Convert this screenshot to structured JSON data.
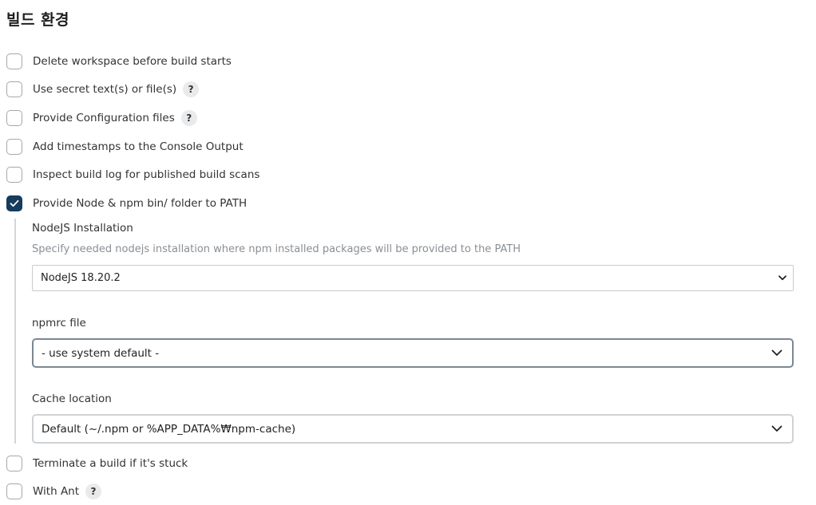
{
  "section": {
    "title": "빌드 환경"
  },
  "options": [
    {
      "label": "Delete workspace before build starts",
      "checked": false,
      "help": false
    },
    {
      "label": "Use secret text(s) or file(s)",
      "checked": false,
      "help": true
    },
    {
      "label": "Provide Configuration files",
      "checked": false,
      "help": true
    },
    {
      "label": "Add timestamps to the Console Output",
      "checked": false,
      "help": false
    },
    {
      "label": "Inspect build log for published build scans",
      "checked": false,
      "help": false
    },
    {
      "label": "Provide Node & npm bin/ folder to PATH",
      "checked": true,
      "help": false
    },
    {
      "label": "Terminate a build if it's stuck",
      "checked": false,
      "help": false
    },
    {
      "label": "With Ant",
      "checked": false,
      "help": true
    }
  ],
  "help_glyph": "?",
  "node_settings": {
    "nodejs_label": "NodeJS Installation",
    "nodejs_description": "Specify needed nodejs installation where npm installed packages will be provided to the PATH",
    "nodejs_value": "NodeJS 18.20.2",
    "npmrc_label": "npmrc file",
    "npmrc_value": "- use system default -",
    "cache_label": "Cache location",
    "cache_value": "Default (~/.npm or %APP_DATA%₩npm-cache)"
  },
  "colors": {
    "checked_fill": "#163b5c",
    "checkbox_border": "#a3a8ad",
    "description_text": "#8a8f94"
  }
}
